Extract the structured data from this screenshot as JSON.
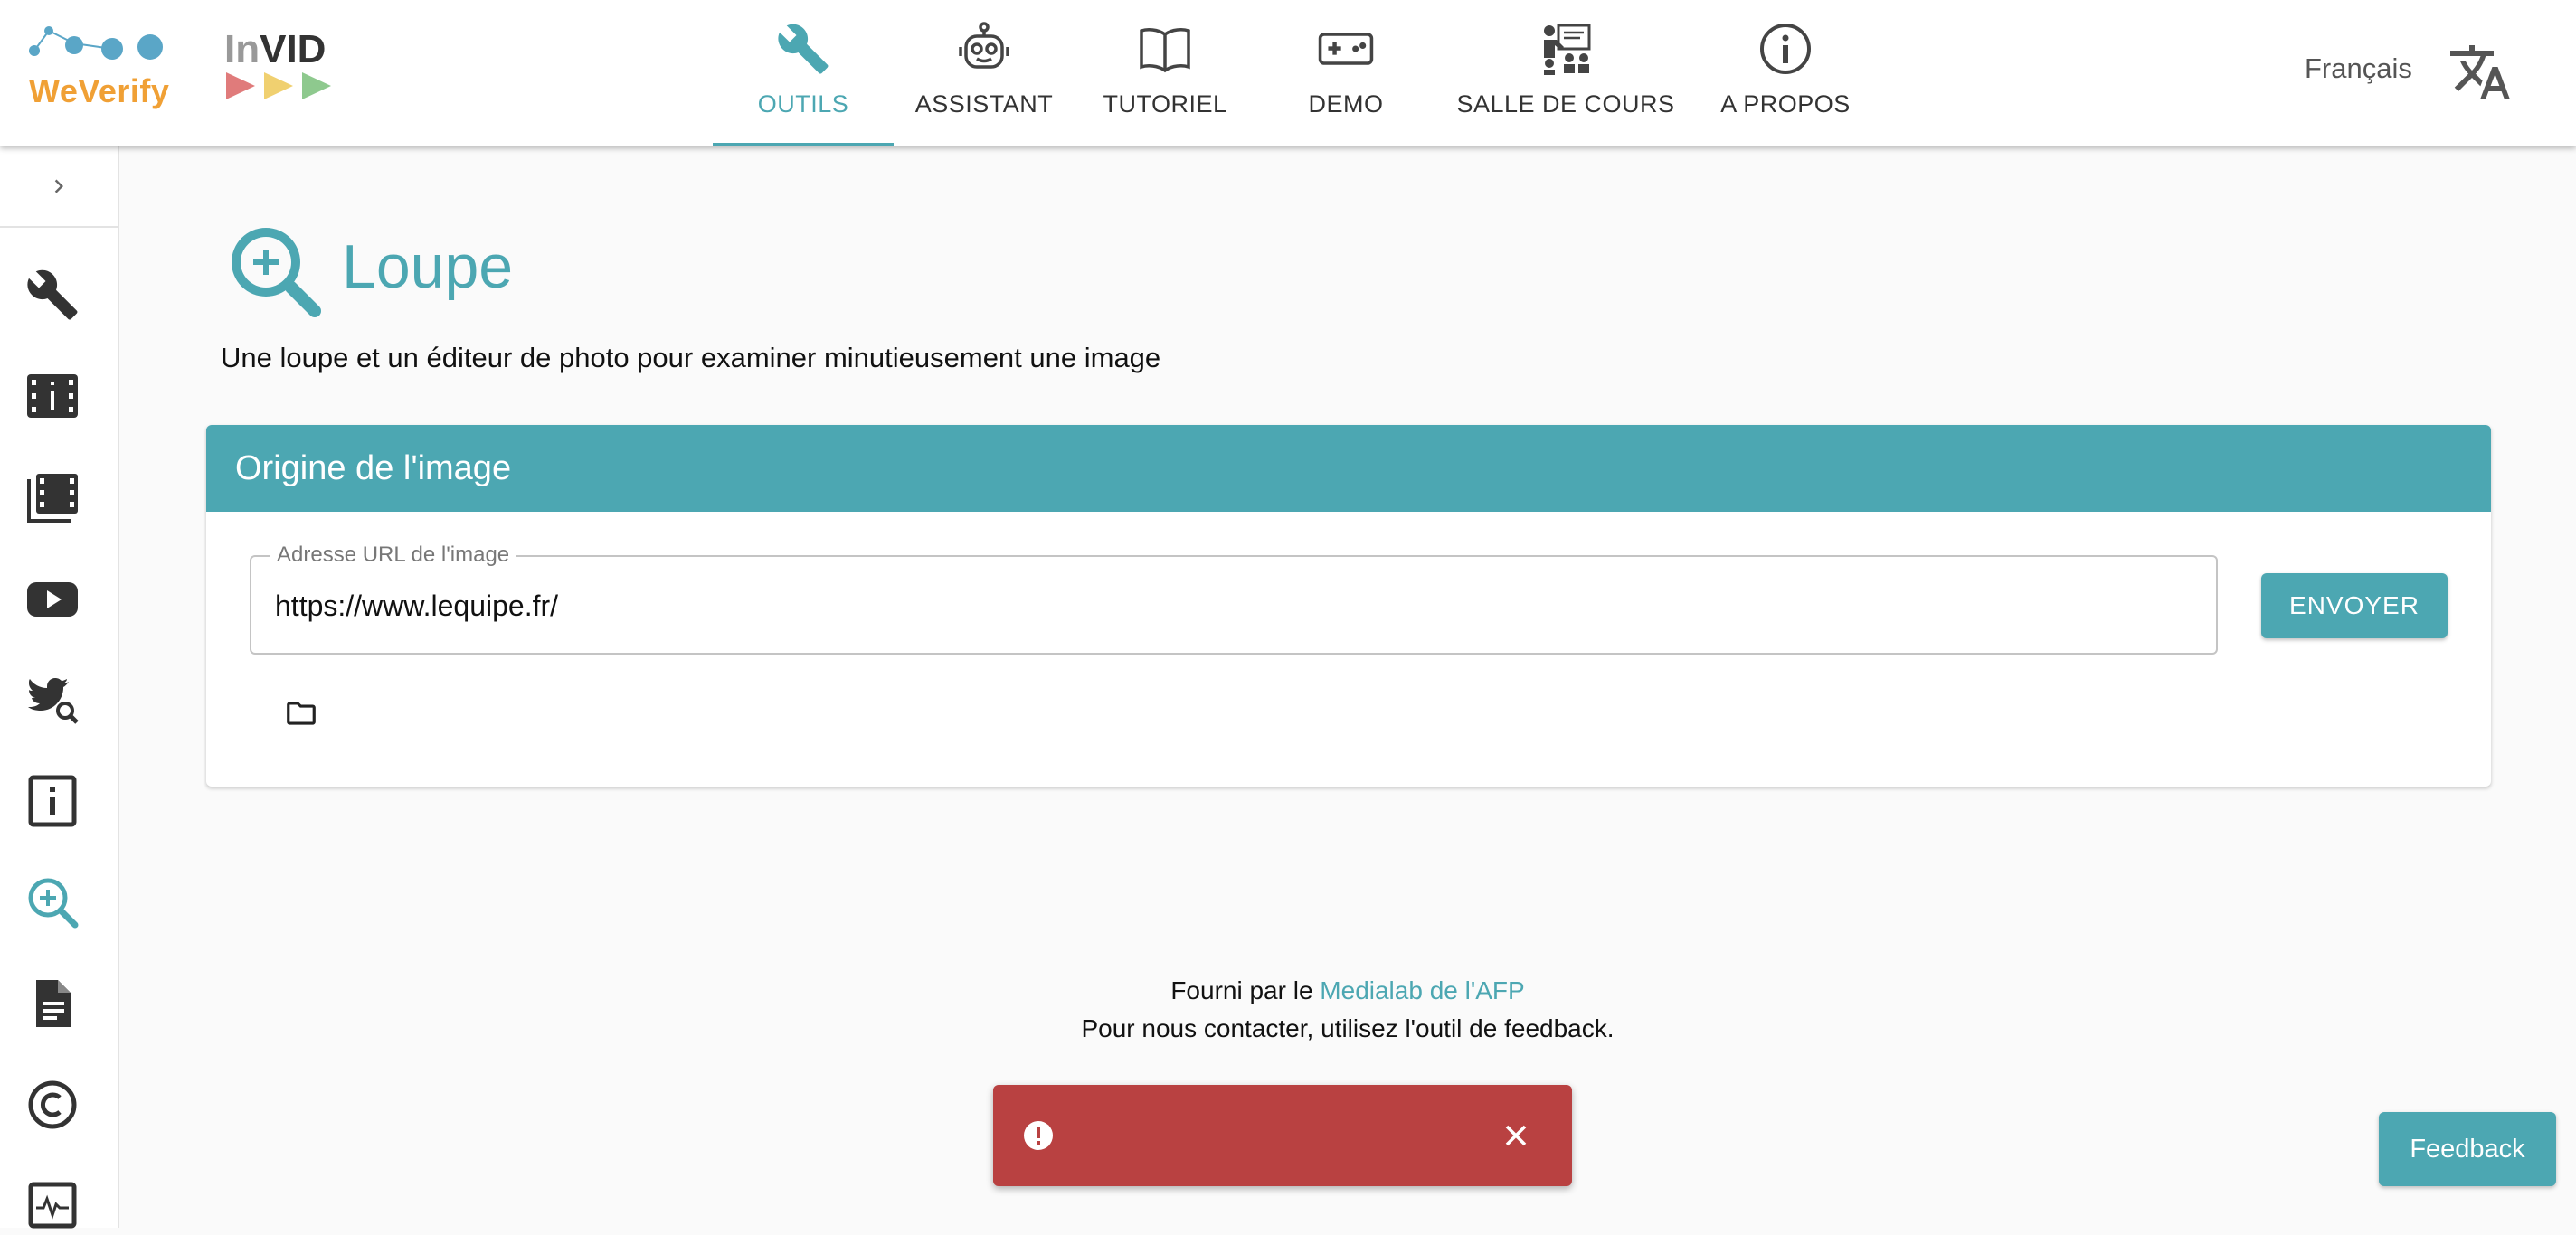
{
  "brand": {
    "weverify": "WeVerify",
    "invid_prefix": "In",
    "invid_suffix": "VID"
  },
  "nav": {
    "tabs": [
      {
        "label": "OUTILS",
        "icon": "wrench-icon",
        "active": true
      },
      {
        "label": "ASSISTANT",
        "icon": "robot-icon",
        "active": false
      },
      {
        "label": "TUTORIEL",
        "icon": "book-icon",
        "active": false
      },
      {
        "label": "DEMO",
        "icon": "gamepad-icon",
        "active": false
      },
      {
        "label": "SALLE DE COURS",
        "icon": "classroom-icon",
        "active": false
      },
      {
        "label": "A PROPOS",
        "icon": "info-icon",
        "active": false
      }
    ],
    "language": "Français"
  },
  "sidebar": {
    "items": [
      {
        "icon": "wrench-icon"
      },
      {
        "icon": "video-analysis-icon"
      },
      {
        "icon": "film-keyframes-icon"
      },
      {
        "icon": "youtube-icon"
      },
      {
        "icon": "twitter-search-icon"
      },
      {
        "icon": "metadata-info-icon"
      },
      {
        "icon": "magnifier-icon",
        "active": true
      },
      {
        "icon": "document-icon"
      },
      {
        "icon": "copyright-icon"
      },
      {
        "icon": "activity-icon"
      }
    ]
  },
  "page": {
    "title": "Loupe",
    "description": "Une loupe et un éditeur de photo pour examiner minutieusement une image"
  },
  "card": {
    "header": "Origine de l'image",
    "url_label": "Adresse URL de l'image",
    "url_value": "https://www.lequipe.fr/",
    "submit_label": "ENVOYER"
  },
  "footer": {
    "line1_prefix": "Fourni par le ",
    "line1_link": "Medialab de l'AFP",
    "line2": "Pour nous contacter, utilisez l'outil de feedback."
  },
  "feedback_label": "Feedback",
  "colors": {
    "accent": "#4ca7b2",
    "error": "#b94141",
    "weverify_orange": "#f0a035"
  }
}
